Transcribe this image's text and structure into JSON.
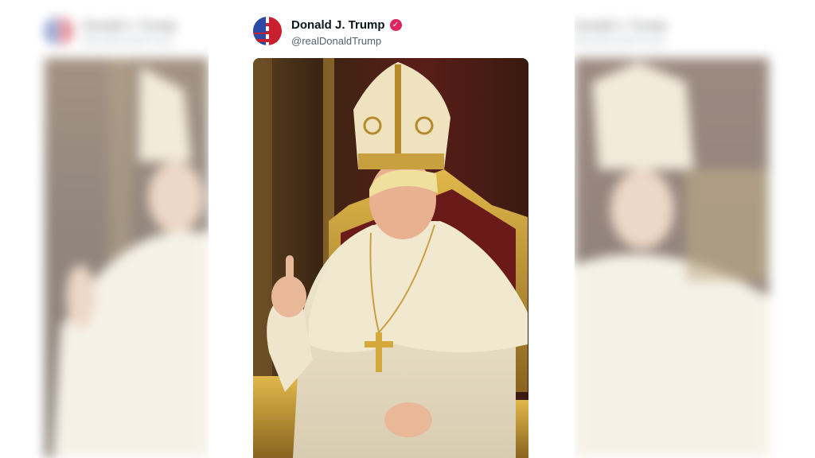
{
  "post": {
    "author_name": "Donald J. Trump",
    "author_handle": "@realDonaldTrump",
    "verified_icon": "verified-badge-icon",
    "image_description_icon": "pope-portrait-image"
  },
  "ghost_left": {
    "author_name": "Donald J. Trump",
    "author_handle": "@realDonaldTrump"
  },
  "ghost_right": {
    "author_name": "Donald J. Trump",
    "author_handle": "@realDonaldTrump"
  },
  "colors": {
    "verified": "#e0245e",
    "name": "#0f1419",
    "handle": "#536471"
  }
}
